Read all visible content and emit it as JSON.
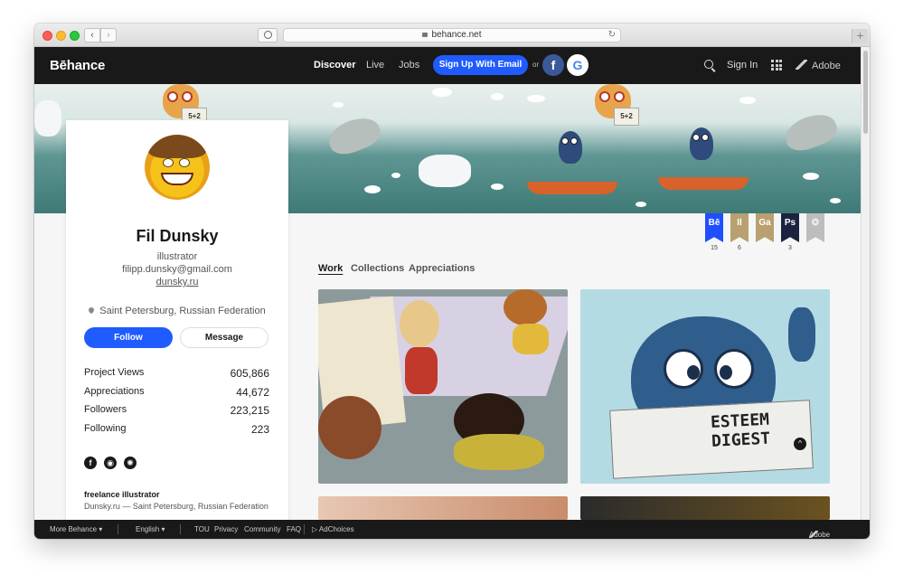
{
  "browser": {
    "url": "behance.net"
  },
  "header": {
    "logo": "Bēhance",
    "nav": [
      "Discover",
      "Live",
      "Jobs"
    ],
    "signup": "Sign Up With Email",
    "or": "or",
    "facebook_glyph": "f",
    "google_glyph": "G",
    "signin": "Sign In",
    "adobe": "Adobe"
  },
  "banner": {
    "paper_text": "5+2"
  },
  "profile": {
    "name": "Fil Dunsky",
    "occupation": "illustrator",
    "email": "filipp.dunsky@gmail.com",
    "website": "dunsky.ru",
    "location": "Saint Petersburg, Russian Federation",
    "follow": "Follow",
    "message": "Message",
    "stats": [
      {
        "label": "Project Views",
        "value": "605,866"
      },
      {
        "label": "Appreciations",
        "value": "44,672"
      },
      {
        "label": "Followers",
        "value": "223,215"
      },
      {
        "label": "Following",
        "value": "223"
      }
    ],
    "social_glyphs": [
      "f",
      "◉",
      "✺"
    ],
    "about_title": "freelance illustrator",
    "about_text": "Dunsky.ru — Saint Petersburg, Russian Federation"
  },
  "badges": [
    {
      "label": "Bē",
      "count": "15",
      "color": "#1f4fff"
    },
    {
      "label": "Il",
      "count": "6",
      "color": "#b8a070"
    },
    {
      "label": "Ga",
      "count": "",
      "color": "#b8a070"
    },
    {
      "label": "Ps",
      "count": "3",
      "color": "#1c2340"
    },
    {
      "label": "❂",
      "count": "",
      "color": "#bdbdbd"
    }
  ],
  "tabs": [
    "Work",
    "Collections",
    "Appreciations"
  ],
  "projects": {
    "digest_title": "ESTEEM DIGEST",
    "scroll_top": "^"
  },
  "footer": {
    "more": "More Behance ▾",
    "language": "English ▾",
    "links": [
      "TOU",
      "Privacy",
      "Community",
      "FAQ"
    ],
    "adchoices": "▷ AdChoices",
    "adobe": "Adobe"
  }
}
